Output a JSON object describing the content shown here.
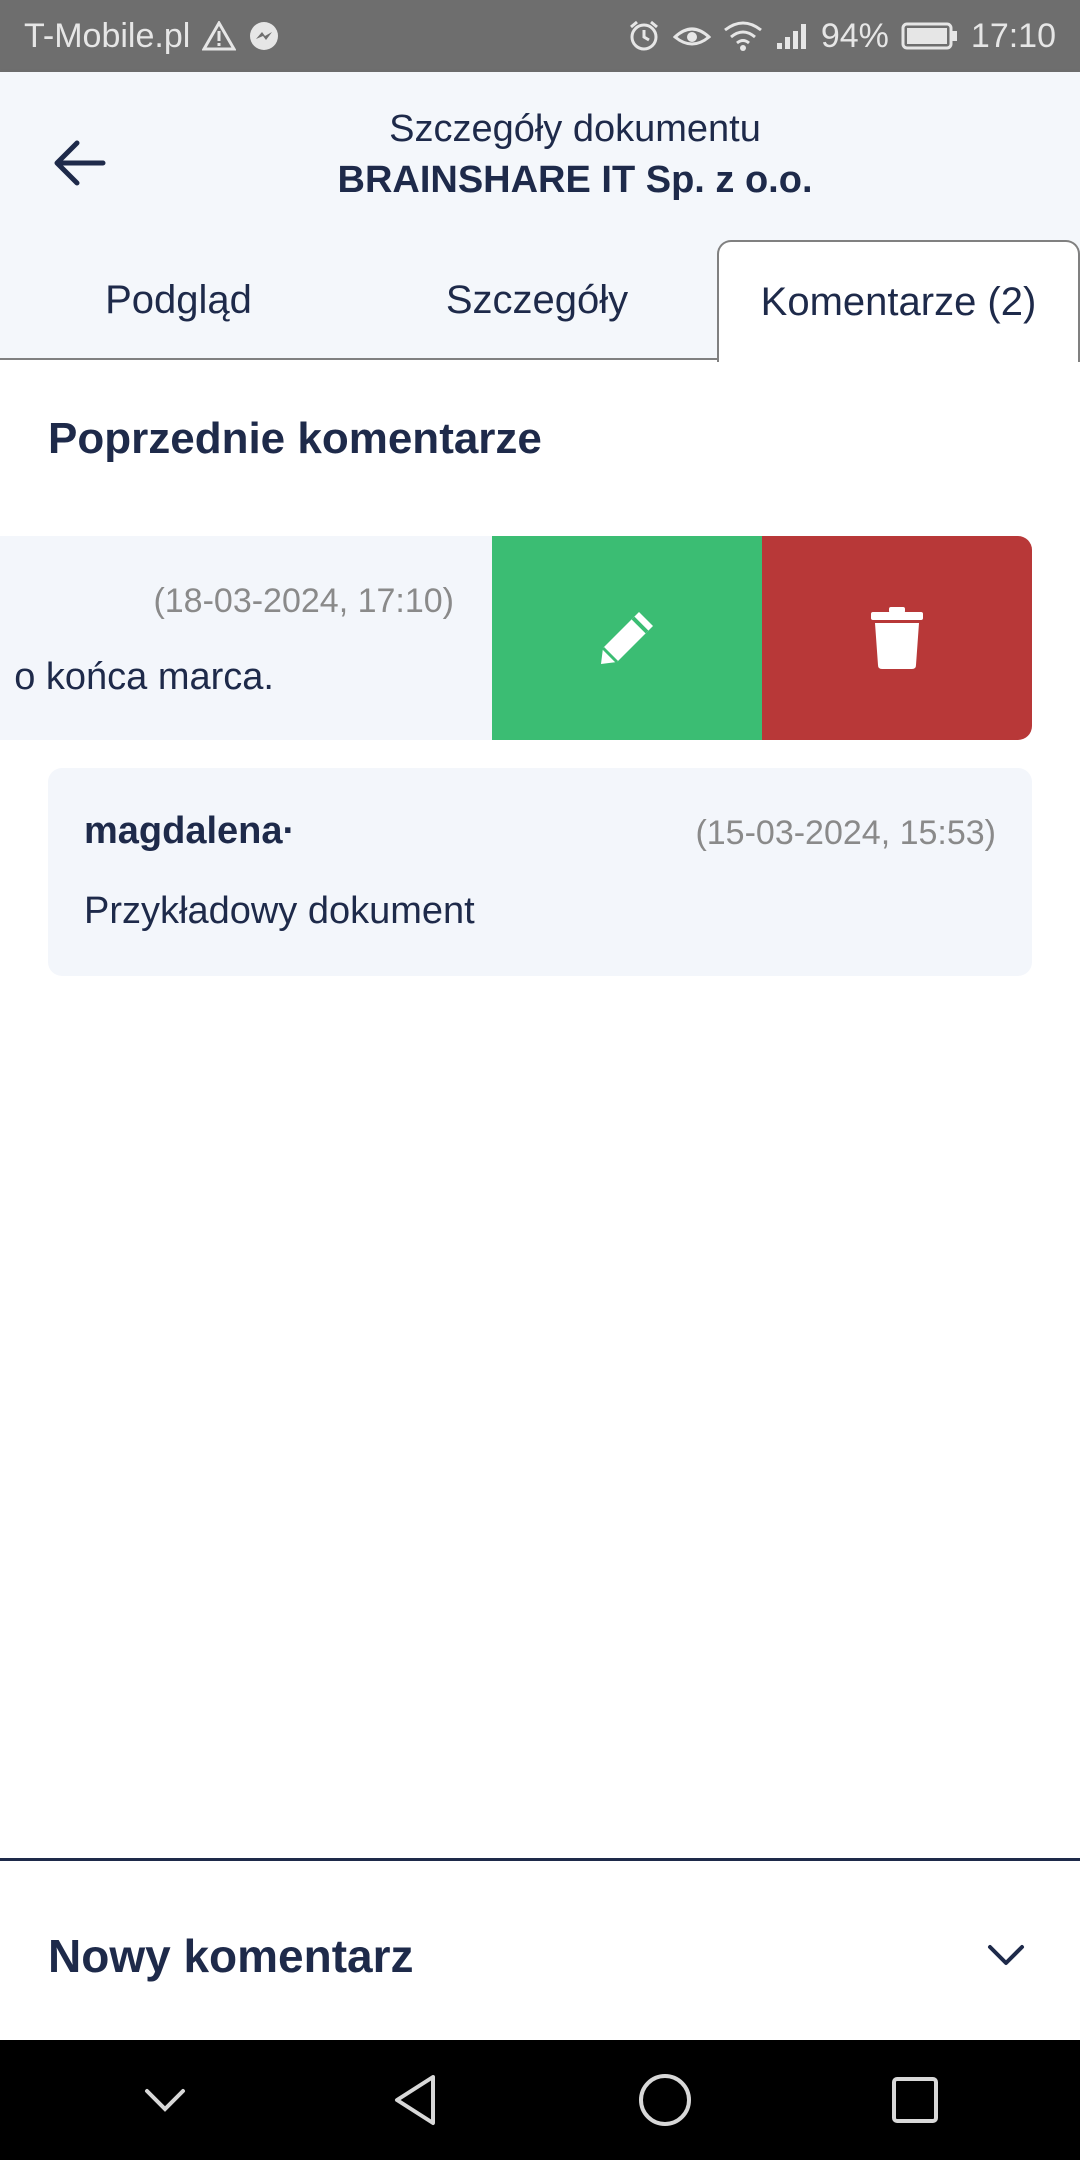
{
  "status_bar": {
    "carrier": "T-Mobile.pl",
    "battery": "94%",
    "time": "17:10"
  },
  "header": {
    "title": "Szczegóły dokumentu",
    "subtitle": "BRAINSHARE IT Sp. z o.o."
  },
  "tabs": [
    {
      "label": "Podgląd"
    },
    {
      "label": "Szczegóły"
    },
    {
      "label": "Komentarze (2)"
    }
  ],
  "comments_section": {
    "title": "Poprzednie komentarze",
    "comments": [
      {
        "author": "",
        "date": "(18-03-2024, 17:10)",
        "text": "o końca marca."
      },
      {
        "author": "magdalena·",
        "date": "(15-03-2024, 15:53)",
        "text": "Przykładowy dokument"
      }
    ],
    "swipe_actions": {
      "edit_icon": "pencil-icon",
      "delete_icon": "trash-icon",
      "edit_color": "#3bbd73",
      "delete_color": "#b83838"
    }
  },
  "new_comment": {
    "label": "Nowy komentarz"
  },
  "colors": {
    "primary_text": "#1e2a4a",
    "card_bg": "#f3f6fb",
    "status_bar_bg": "#6e6e6e"
  }
}
